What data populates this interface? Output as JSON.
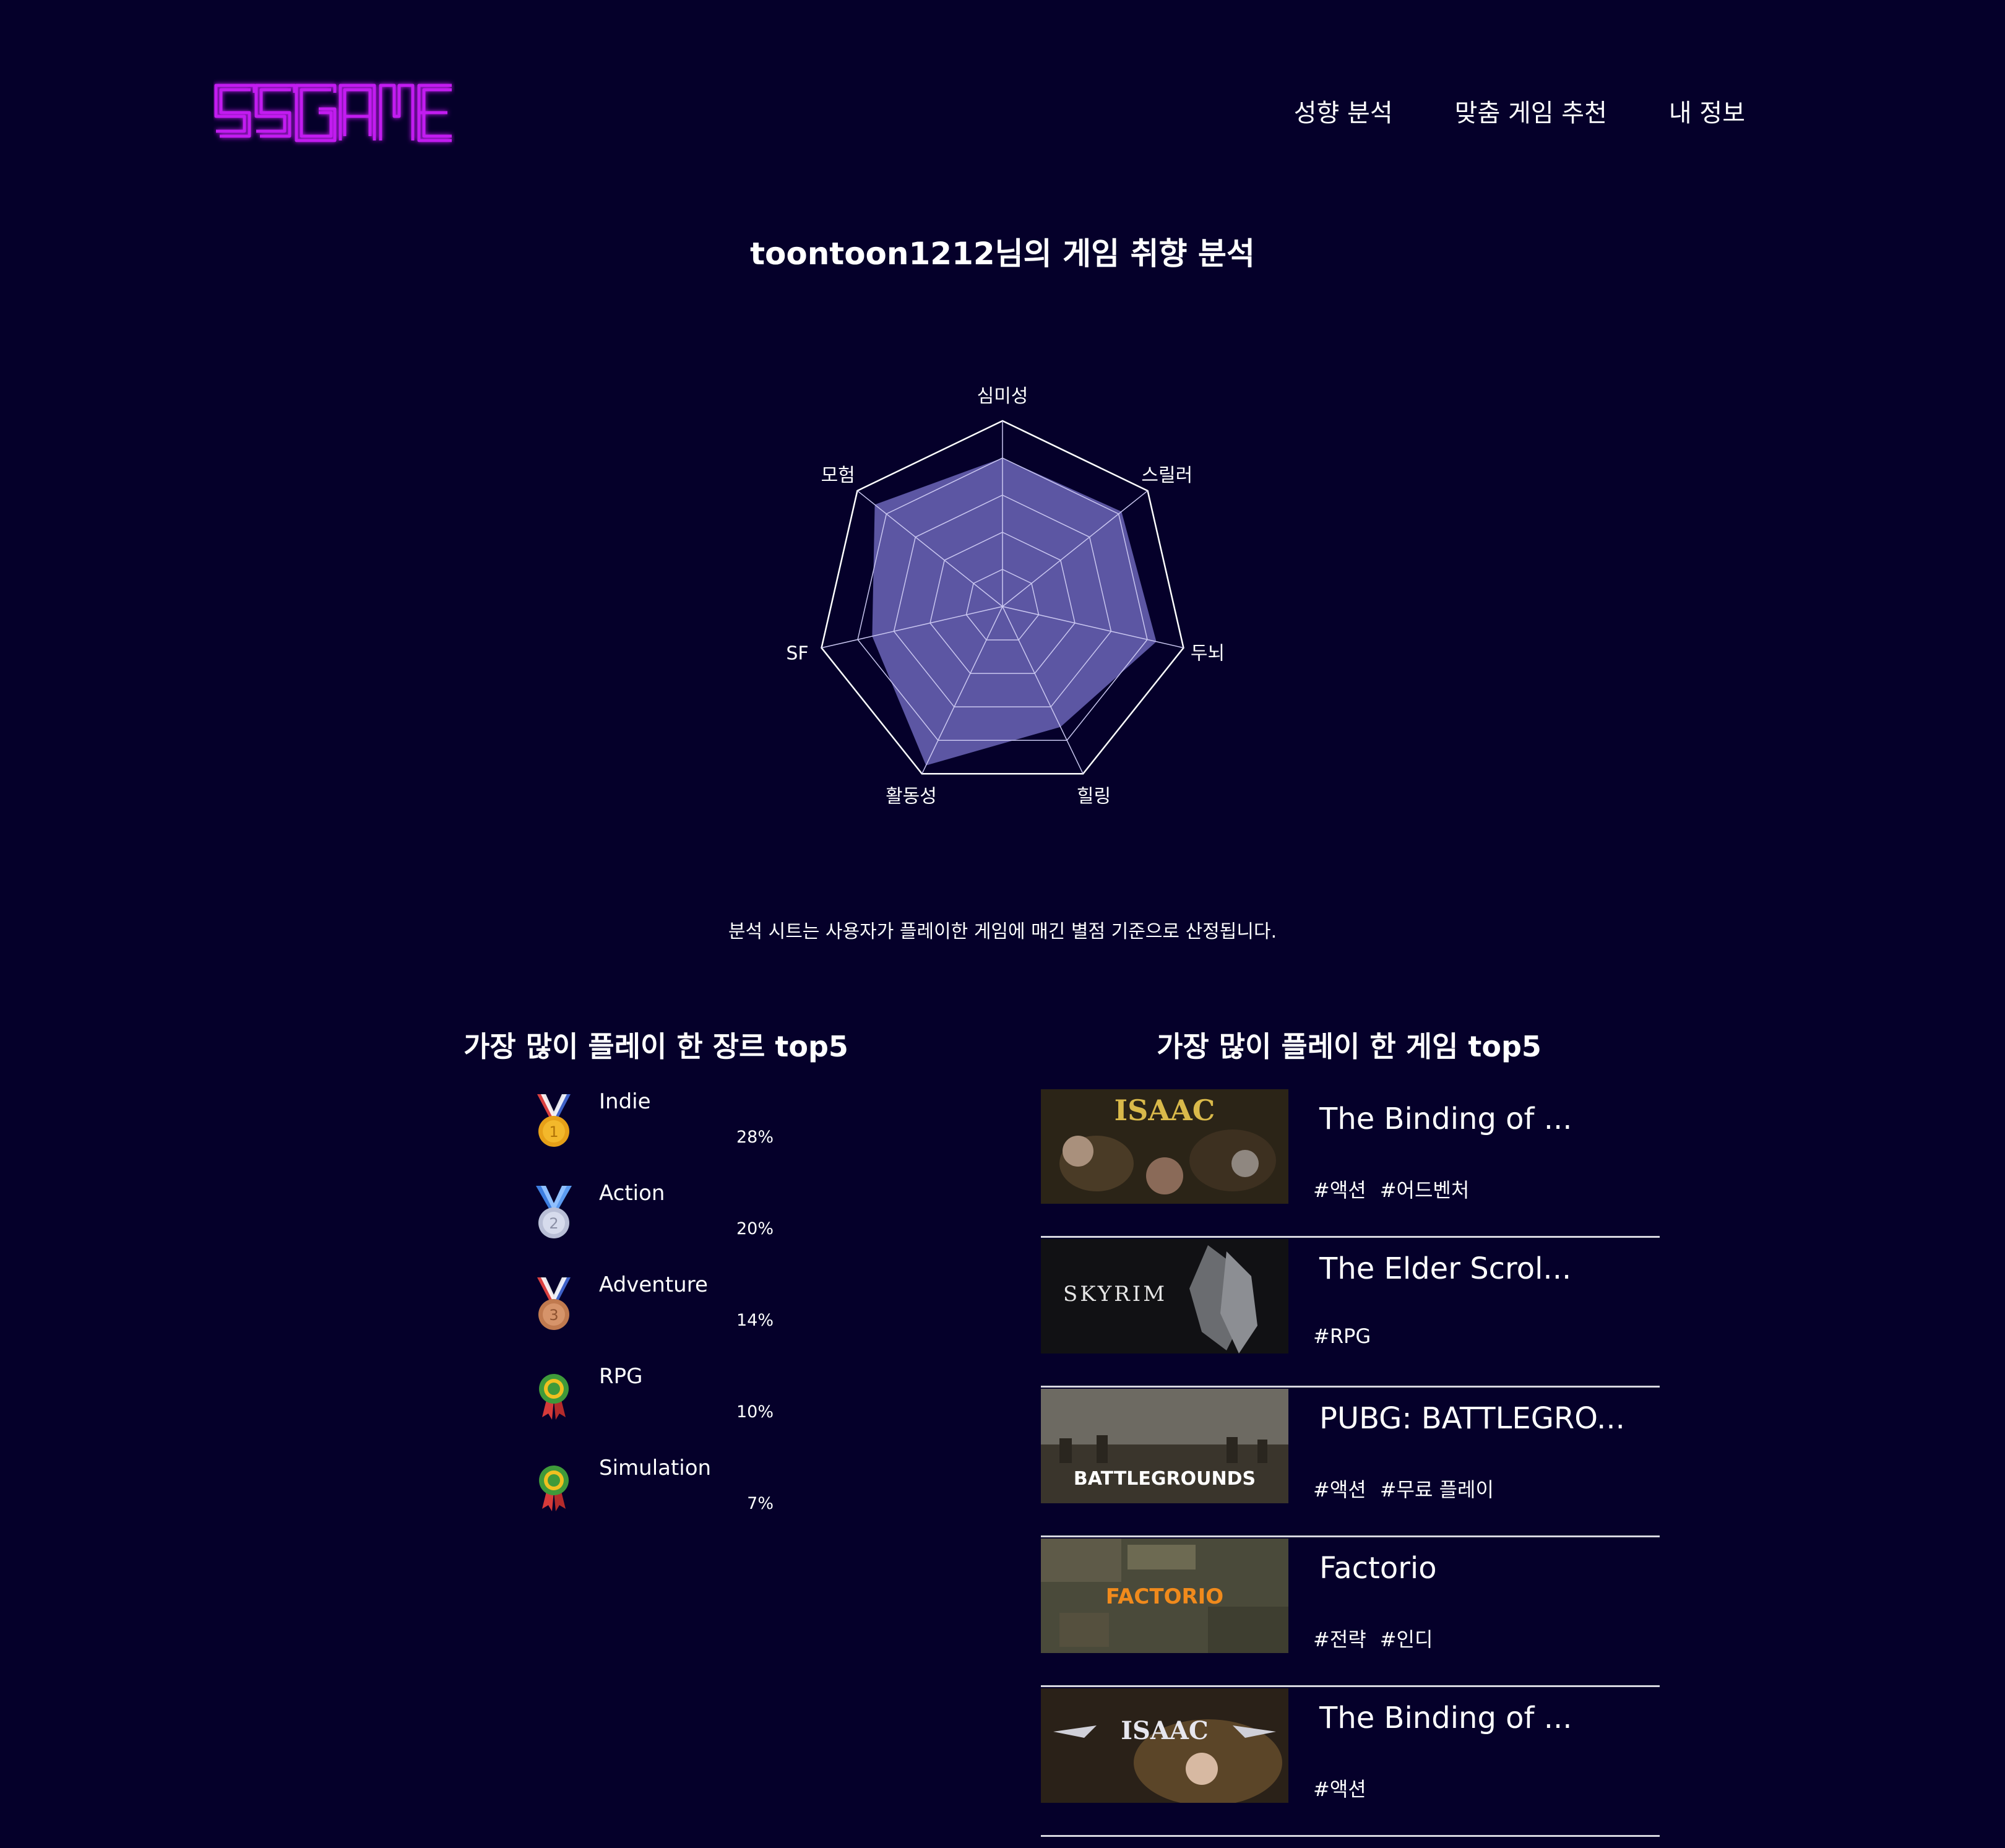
{
  "header": {
    "logo_text": "SSGAME",
    "nav": [
      "성향 분석",
      "맞춤 게임 추천",
      "내 정보"
    ]
  },
  "page_title": "toontoon1212님의 게임 취향 분석",
  "radar": {
    "axes": [
      "심미성",
      "스릴러",
      "두뇌",
      "힐링",
      "활동성",
      "SF",
      "모험"
    ],
    "values": [
      0.8,
      0.82,
      0.85,
      0.72,
      0.95,
      0.72,
      0.88
    ],
    "fill_color": "#7a73cc"
  },
  "note": "분석 시트는 사용자가 플레이한 게임에 매긴 별점 기준으로 산정됩니다.",
  "genres": {
    "title": "가장 많이 플레이 한 장르 top5",
    "items": [
      {
        "name": "Indie",
        "pct": "28%",
        "medal": "gold-medal-icon"
      },
      {
        "name": "Action",
        "pct": "20%",
        "medal": "silver-medal-icon"
      },
      {
        "name": "Adventure",
        "pct": "14%",
        "medal": "bronze-medal-icon"
      },
      {
        "name": "RPG",
        "pct": "10%",
        "medal": "rosette-icon"
      },
      {
        "name": "Simulation",
        "pct": "7%",
        "medal": "rosette-icon"
      }
    ]
  },
  "games": {
    "title": "가장 많이 플레이 한 게임 top5",
    "items": [
      {
        "name": "The Binding of ...",
        "tags": [
          "#액션",
          "#어드벤처"
        ],
        "thumb_text": "ISAAC"
      },
      {
        "name": "The Elder Scrol...",
        "tags": [
          "#RPG"
        ],
        "thumb_text": "SKYRIM"
      },
      {
        "name": "PUBG: BATTLEGRO...",
        "tags": [
          "#액션",
          "#무료 플레이"
        ],
        "thumb_text": "BATTLEGROUNDS"
      },
      {
        "name": "Factorio",
        "tags": [
          "#전략",
          "#인디"
        ],
        "thumb_text": "FACTORIO"
      },
      {
        "name": "The Binding of ...",
        "tags": [
          "#액션"
        ],
        "thumb_text": "ISAAC"
      }
    ]
  }
}
